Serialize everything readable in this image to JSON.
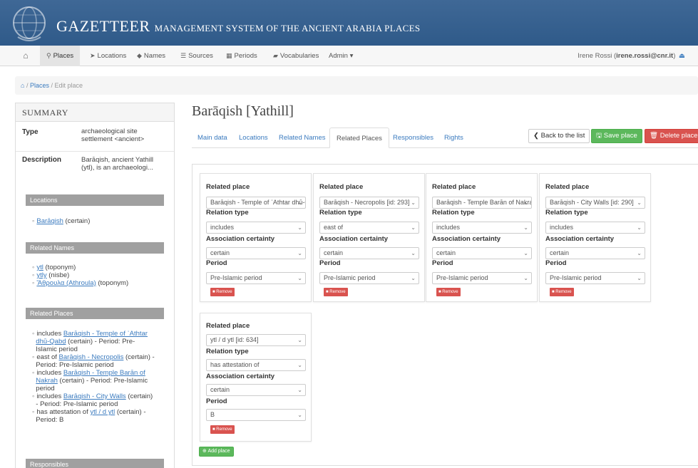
{
  "header": {
    "brand_big": "GAZETTEER",
    "brand_small": "MANAGEMENT SYSTEM OF THE ANCIENT ARABIA PLACES"
  },
  "nav": {
    "home_icon": "home-icon",
    "items": [
      {
        "label": "Places",
        "icon": "map-marker-icon",
        "active": true
      },
      {
        "label": "Locations",
        "icon": "location-arrow-icon"
      },
      {
        "label": "Names",
        "icon": "tag-icon"
      },
      {
        "label": "Sources",
        "icon": "list-icon"
      },
      {
        "label": "Periods",
        "icon": "calendar-icon"
      },
      {
        "label": "Vocabularies",
        "icon": "book-icon"
      },
      {
        "label": "Admin ▾"
      }
    ],
    "user_name": "Irene Rossi",
    "user_email": "irene.rossi@cnr.it"
  },
  "breadcrumb": {
    "places": "Places",
    "current": "Edit place"
  },
  "summary": {
    "title": "SUMMARY",
    "type_label": "Type",
    "type_value": [
      "archaeological site",
      "settlement <ancient>"
    ],
    "desc_label": "Description",
    "desc_value": [
      "Barāqish, ancient Yathill",
      "(ytl), is an archaeologi..."
    ],
    "locations_title": "Locations",
    "locations": [
      {
        "link": "Barāqish",
        "text": " (certain)"
      }
    ],
    "names_title": "Related Names",
    "names": [
      {
        "link": "ytl",
        "text": " (toponym)"
      },
      {
        "link": "ytly",
        "text": " (nisbe)"
      },
      {
        "link": "Ἄθρουλα (Athroula)",
        "text": " (toponym)"
      }
    ],
    "places_title": "Related Places",
    "places": [
      [
        "includes ",
        "Barāqish - Temple of ʿAthtar",
        "dhū-Qabḍ",
        " (certain) - Period: Pre-",
        "Islamic period"
      ],
      [
        "east of ",
        "Barāqish - Necropolis",
        " (certain) -",
        "Period: Pre-Islamic period"
      ],
      [
        "includes ",
        "Barāqish - Temple Barān of",
        "Nakrah",
        " (certain) - Period: Pre-Islamic",
        "period"
      ],
      [
        "includes ",
        "Barāqish - City Walls",
        " (certain)",
        "- Period: Pre-Islamic period"
      ],
      [
        "has attestation of ",
        "ytl / d ytl",
        " (certain) -",
        "Period: B"
      ]
    ],
    "responsibles_title": "Responsibles"
  },
  "main": {
    "title": "Barāqish [Yathill]",
    "tabs": [
      "Main data",
      "Locations",
      "Related Names",
      "Related Places",
      "Responsibles",
      "Rights"
    ],
    "active_tab": "Related Places",
    "back_label": "Back to the list",
    "save_label": "Save place",
    "delete_label": "Delete place",
    "add_label": "Add place"
  },
  "labels": {
    "related_place": "Related place",
    "relation_type": "Relation type",
    "association_certainty": "Association certainty",
    "period": "Period",
    "remove": "Remove"
  },
  "relations": [
    {
      "place": "Barāqish - Temple of ʿAthtar dhū-Qabḍ",
      "relation": "includes",
      "certainty": "certain",
      "period": "Pre-Islamic period"
    },
    {
      "place": "Barāqish - Necropolis [id: 293]",
      "relation": "east of",
      "certainty": "certain",
      "period": "Pre-Islamic period"
    },
    {
      "place": "Barāqish - Temple Barān of Nakrah",
      "relation": "includes",
      "certainty": "certain",
      "period": "Pre-Islamic period"
    },
    {
      "place": "Barāqish - City Walls [id: 290]",
      "relation": "includes",
      "certainty": "certain",
      "period": "Pre-Islamic period"
    },
    {
      "place": "ytl / d ytl [id: 634]",
      "relation": "has attestation of",
      "certainty": "certain",
      "period": "B"
    }
  ],
  "colors": {
    "banner": "#2f5a89",
    "link": "#3b7bbf",
    "success": "#5cb85c",
    "danger": "#d9534f"
  }
}
